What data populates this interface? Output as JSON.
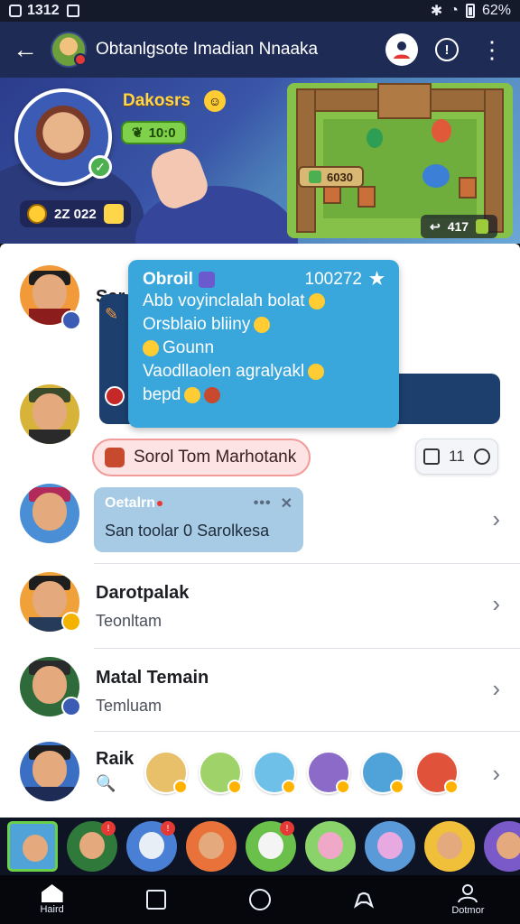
{
  "status_bar": {
    "time": "1312",
    "battery": "62%"
  },
  "app_bar": {
    "title": "Obtanlgsote Imadian Nnaaka"
  },
  "banner": {
    "player_name": "Dakosrs",
    "level_badge": "10:0",
    "stats_text": "2Z  022",
    "top_score": "6030",
    "counter": "417",
    "counter_icon": "gem-icon"
  },
  "message_bubble": {
    "title": "Obroil",
    "number": "100272",
    "lines": [
      "Abb voyinclalah bolat",
      "Orsblaio bliiny",
      "Gounn",
      "Vaodllaolen agralyakl",
      "bepd"
    ]
  },
  "rows": [
    {
      "name": "Sar",
      "subtitle": ""
    },
    {
      "name": "",
      "subtitle": ""
    },
    {
      "name": "",
      "subtitle": ""
    },
    {
      "name": "Darotpalak",
      "subtitle": "Teonltam"
    },
    {
      "name": "Matal Temain",
      "subtitle": "Temluam"
    },
    {
      "name": "Raik",
      "subtitle": ""
    }
  ],
  "tag_pill": {
    "label": "Sorol Tom Marhotank"
  },
  "count_pill": {
    "value": "11"
  },
  "small_bubble": {
    "title": "Oetalrn",
    "message": "San toolar 0 Sarolkesa"
  },
  "nav": [
    {
      "label": "Haird",
      "icon": "home-icon"
    },
    {
      "label": "",
      "icon": "square-icon"
    },
    {
      "label": "",
      "icon": "circle-icon"
    },
    {
      "label": "",
      "icon": "controller-icon"
    },
    {
      "label": "Dotmor",
      "icon": "profile-icon"
    }
  ],
  "colors": {
    "app_bar": "#1e2b55",
    "accent": "#3aa7dc",
    "tag_red": "#fde3e3"
  }
}
